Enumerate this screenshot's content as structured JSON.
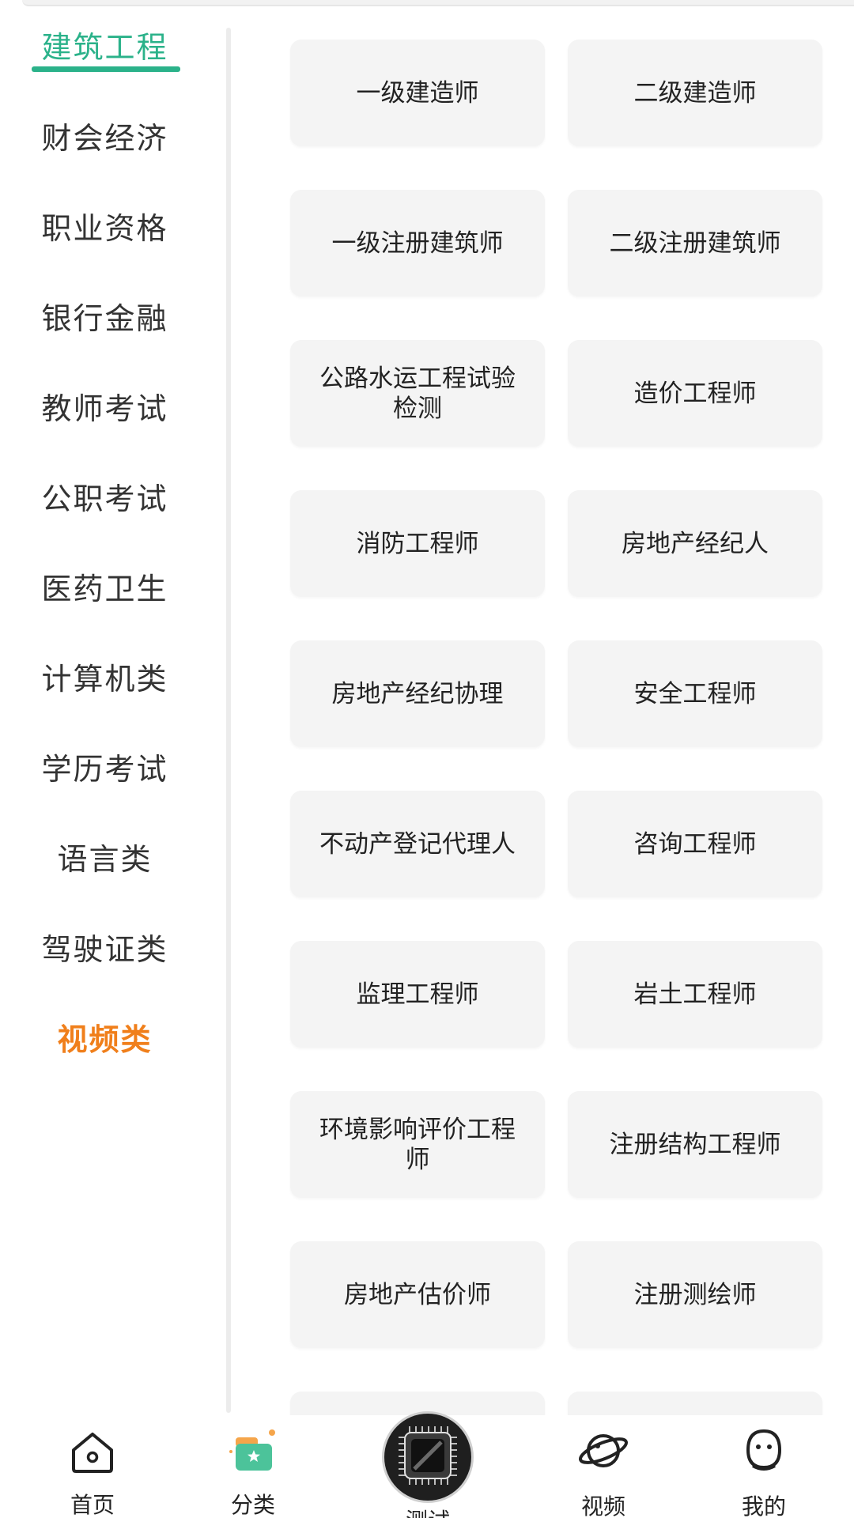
{
  "sidebar": {
    "items": [
      {
        "label": "建筑工程"
      },
      {
        "label": "财会经济"
      },
      {
        "label": "职业资格"
      },
      {
        "label": "银行金融"
      },
      {
        "label": "教师考试"
      },
      {
        "label": "公职考试"
      },
      {
        "label": "医药卫生"
      },
      {
        "label": "计算机类"
      },
      {
        "label": "学历考试"
      },
      {
        "label": "语言类"
      },
      {
        "label": "驾驶证类"
      },
      {
        "label": "视频类"
      }
    ],
    "active_index": 0,
    "highlight_index": 11
  },
  "exams": [
    {
      "label": "一级建造师"
    },
    {
      "label": "二级建造师"
    },
    {
      "label": "一级注册建筑师"
    },
    {
      "label": "二级注册建筑师"
    },
    {
      "label": "公路水运工程试验检测"
    },
    {
      "label": "造价工程师"
    },
    {
      "label": "消防工程师"
    },
    {
      "label": "房地产经纪人"
    },
    {
      "label": "房地产经纪协理"
    },
    {
      "label": "安全工程师"
    },
    {
      "label": "不动产登记代理人"
    },
    {
      "label": "咨询工程师"
    },
    {
      "label": "监理工程师"
    },
    {
      "label": "岩土工程师"
    },
    {
      "label": "环境影响评价工程师"
    },
    {
      "label": "注册结构工程师"
    },
    {
      "label": "房地产估价师"
    },
    {
      "label": "注册测绘师"
    }
  ],
  "tabbar": {
    "home": "首页",
    "category": "分类",
    "test": "测试",
    "video": "视频",
    "mine": "我的"
  },
  "colors": {
    "accent": "#2bb28a",
    "highlight": "#f07f1b"
  }
}
